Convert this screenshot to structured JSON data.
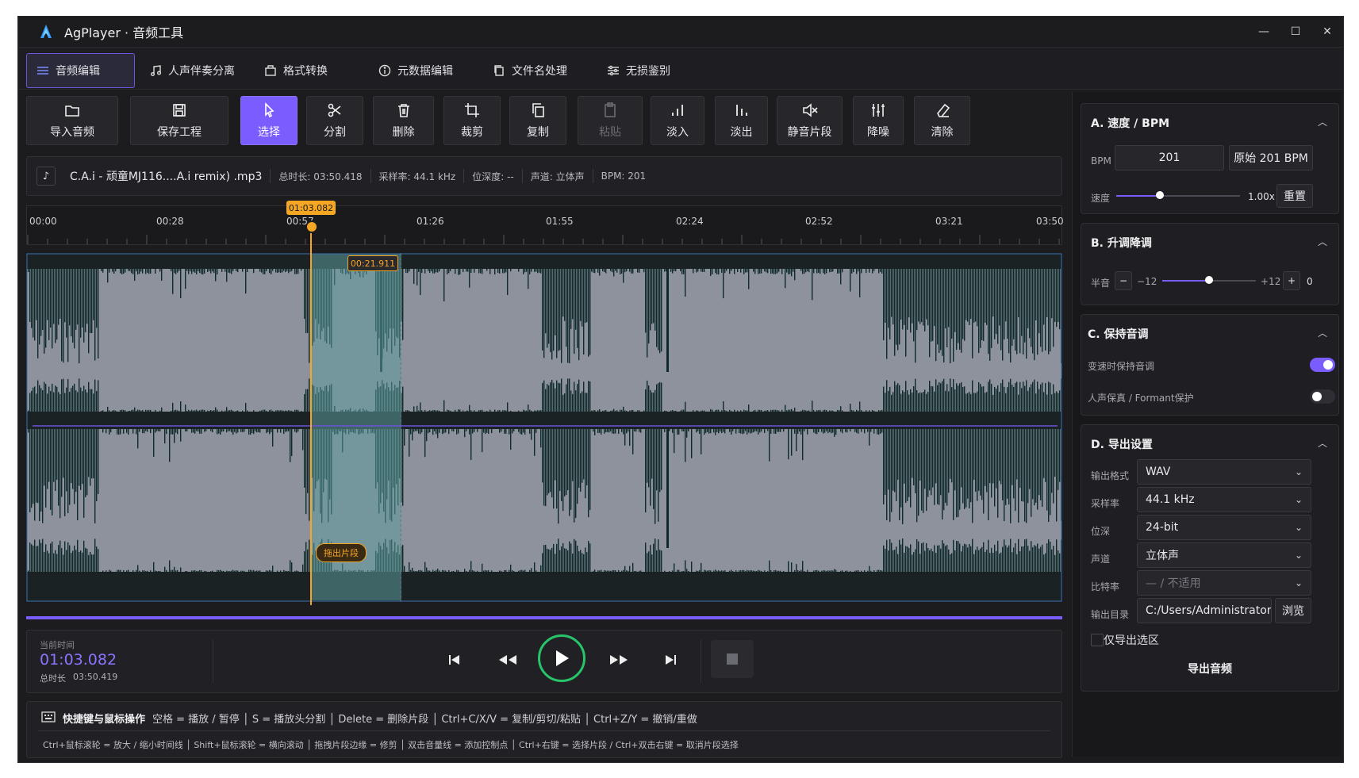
{
  "app": {
    "title": "AgPlayer · 音频工具"
  },
  "tabs": [
    {
      "label": "音频编辑"
    },
    {
      "label": "人声伴奏分离"
    },
    {
      "label": "格式转换"
    },
    {
      "label": "元数据编辑"
    },
    {
      "label": "文件名处理"
    },
    {
      "label": "无损鉴别"
    }
  ],
  "toolbar": [
    {
      "label": "导入音频",
      "icon": "folder-open-icon"
    },
    {
      "label": "保存工程",
      "icon": "save-icon"
    },
    {
      "label": "选择",
      "icon": "cursor-icon"
    },
    {
      "label": "分割",
      "icon": "scissors-icon"
    },
    {
      "label": "删除",
      "icon": "trash-icon"
    },
    {
      "label": "裁剪",
      "icon": "crop-icon"
    },
    {
      "label": "复制",
      "icon": "copy-icon"
    },
    {
      "label": "粘贴",
      "icon": "paste-icon"
    },
    {
      "label": "淡入",
      "icon": "fade-in-icon"
    },
    {
      "label": "淡出",
      "icon": "fade-out-icon"
    },
    {
      "label": "静音片段",
      "icon": "mute-icon"
    },
    {
      "label": "降噪",
      "icon": "sliders-icon"
    },
    {
      "label": "清除",
      "icon": "eraser-icon"
    }
  ],
  "file": {
    "name": "C.A.i - 顽童MJ116....A.i remix) .mp3",
    "duration": "总时长: 03:50.418",
    "sample_rate": "采样率: 44.1 kHz",
    "bit_depth": "位深度: --",
    "channels": "声道: 立体声",
    "bpm": "BPM: 201"
  },
  "timeline": {
    "ticks": [
      "00:00",
      "00:28",
      "00:57",
      "01:26",
      "01:55",
      "02:24",
      "02:52",
      "03:21",
      "03:50"
    ],
    "playhead_label": "01:03.082",
    "selection_label": "00:21.911",
    "drag_label": "拖出片段"
  },
  "transport": {
    "current_label": "当前时间",
    "current_time": "01:03.082",
    "total_label": "总时长",
    "total_time": "03:50.419"
  },
  "shortcuts": {
    "title": "快捷键与鼠标操作",
    "line1": "空格 = 播放 / 暂停 │ S = 播放头分割 │ Delete = 删除片段 │ Ctrl+C/X/V = 复制/剪切/粘贴 │ Ctrl+Z/Y = 撤销/重做",
    "line2": "Ctrl+鼠标滚轮 = 放大 / 缩小时间线 │ Shift+鼠标滚轮 = 横向滚动 │ 拖拽片段边缘 = 修剪 │ 双击音量线 = 添加控制点 │ Ctrl+右键 = 选择片段 / Ctrl+双击右键 = 取消片段选择"
  },
  "panel": {
    "speed": {
      "title": "A. 速度 / BPM",
      "bpm_label": "BPM",
      "bpm_value": "201",
      "original": "原始 201 BPM",
      "speed_label": "速度",
      "speed_value": "1.00x",
      "speed_fraction": 0.35,
      "reset": "重置"
    },
    "pitch": {
      "title": "B. 升调降调",
      "label": "半音",
      "minus": "−",
      "min": "−12",
      "max": "+12",
      "plus": "+",
      "value": "0",
      "fraction": 0.5
    },
    "keep": {
      "title": "C. 保持音调",
      "opt1": "变速时保持音调",
      "opt1_on": true,
      "opt2": "人声保真 / Formant保护",
      "opt2_on": false
    },
    "export": {
      "title": "D. 导出设置",
      "format_label": "输出格式",
      "format": "WAV",
      "rate_label": "采样率",
      "rate": "44.1 kHz",
      "depth_label": "位深",
      "depth": "24-bit",
      "channel_label": "声道",
      "channel": "立体声",
      "bitrate_label": "比特率",
      "bitrate": "— / 不适用",
      "dir_label": "输出目录",
      "dir": "C:/Users/Administrator/",
      "browse": "浏览",
      "only_selection": "仅导出选区",
      "export_button": "导出音频"
    }
  },
  "colors": {
    "accent": "#7a5cff",
    "playhead": "#f5a623",
    "play_ring": "#28c46a",
    "wave": "#0f2a2a",
    "wave_bg": "#8e929d"
  }
}
